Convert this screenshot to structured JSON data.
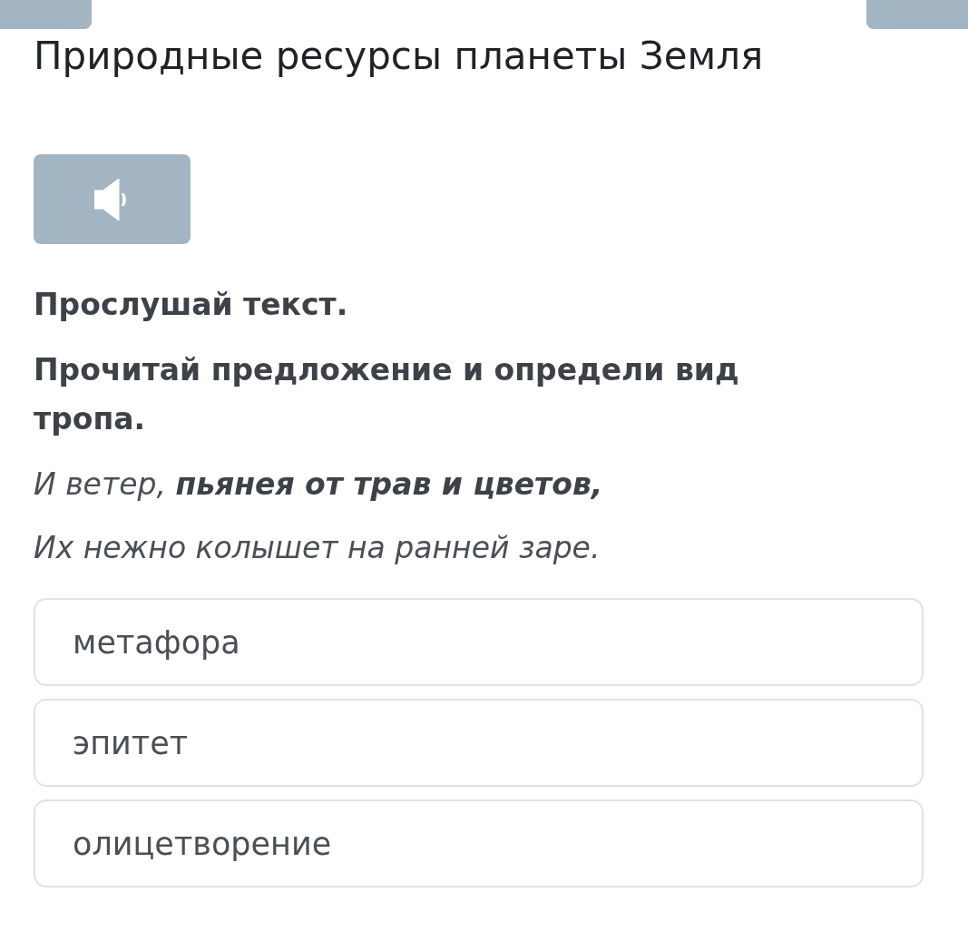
{
  "title": "Природные ресурсы планеты Земля",
  "instructions": [
    "Прослушай текст.",
    "Прочитай предложение и определи вид тропа."
  ],
  "quote": [
    "И ветер, **пьянея от трав и цветов,**",
    "Их нежно колышет на ранней заре."
  ],
  "options": [
    {
      "label": "метафора",
      "selected": false
    },
    {
      "label": "эпитет",
      "selected": false
    },
    {
      "label": "олицетворение",
      "selected": false
    }
  ]
}
